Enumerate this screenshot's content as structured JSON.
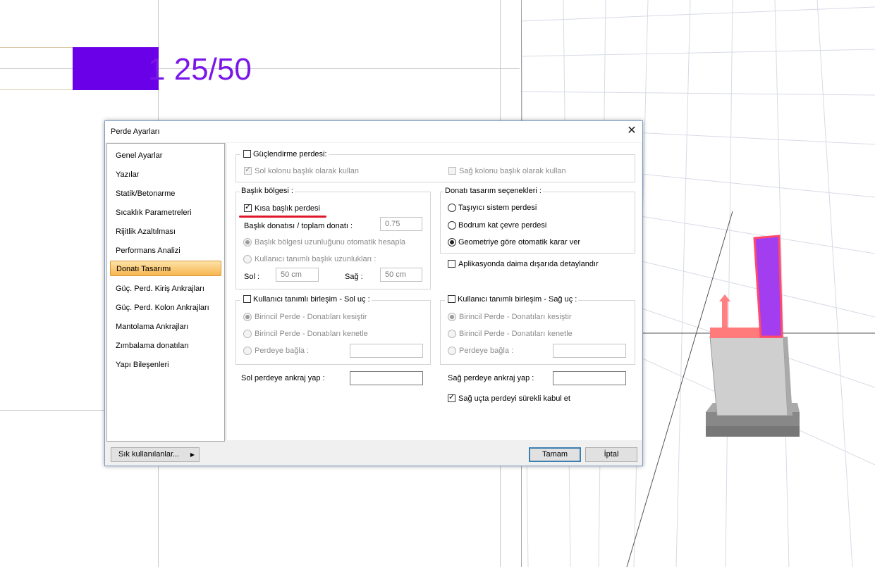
{
  "background": {
    "beam_label": "1 25/50"
  },
  "dialog": {
    "title": "Perde Ayarları",
    "nav_items": [
      "Genel Ayarlar",
      "Yazılar",
      "Statik/Betonarme",
      "Sıcaklık Parametreleri",
      "Rijitlik Azaltılması",
      "Performans Analizi",
      "Donatı Tasarımı",
      "Güç. Perd. Kiriş Ankrajları",
      "Güç. Perd. Kolon Ankrajları",
      "Mantolama Ankrajları",
      "Zımbalama donatıları",
      "Yapı Bileşenleri"
    ],
    "selected_nav": "Donatı Tasarımı",
    "guclendirme": {
      "label": "Güçlendirme perdesi:",
      "sol_kolon": "Sol kolonu başlık olarak kullan",
      "sag_kolon": "Sağ kolonu başlık olarak kullan"
    },
    "baslik": {
      "title": "Başlık bölgesi :",
      "kisa": "Kısa başlık perdesi",
      "donati_label": "Başlık donatısı / toplam donatı :",
      "donati_value": "0.75",
      "otomatik": "Başlık bölgesi uzunluğunu otomatik hesapla",
      "kullanici": "Kullanıcı tanımlı başlık uzunlukları :",
      "sol_label": "Sol :",
      "sol_value": "50 cm",
      "sag_label": "Sağ :",
      "sag_value": "50 cm"
    },
    "donati_tasarim": {
      "title": "Donatı tasarım seçenekleri :",
      "opt1": "Taşıyıcı sistem perdesi",
      "opt2": "Bodrum kat çevre perdesi",
      "opt3": "Geometriye göre otomatik karar ver",
      "aplikasyon": "Aplikasyonda daima dışarıda detaylandır"
    },
    "sol_uc": {
      "title": "Kullanıcı tanımlı birleşim - Sol uç :",
      "opt1": "Birincil Perde - Donatıları kesiştir",
      "opt2": "Birincil Perde - Donatıları kenetle",
      "opt3": "Perdeye bağla :"
    },
    "sag_uc": {
      "title": "Kullanıcı tanımlı birleşim - Sağ uç :",
      "opt1": "Birincil Perde - Donatıları kesiştir",
      "opt2": "Birincil Perde - Donatıları kenetle",
      "opt3": "Perdeye bağla :"
    },
    "sol_ankraj": "Sol perdeye ankraj yap :",
    "sag_ankraj": "Sağ perdeye ankraj yap :",
    "sag_surekli": "Sağ uçta perdeyi sürekli kabul et",
    "sik_kullanilanlar": "Sık kullanılanlar...",
    "tamam": "Tamam",
    "iptal": "İptal"
  },
  "colors": {
    "accent_purple": "#6a00e8",
    "highlight_red": "#e0162a"
  }
}
